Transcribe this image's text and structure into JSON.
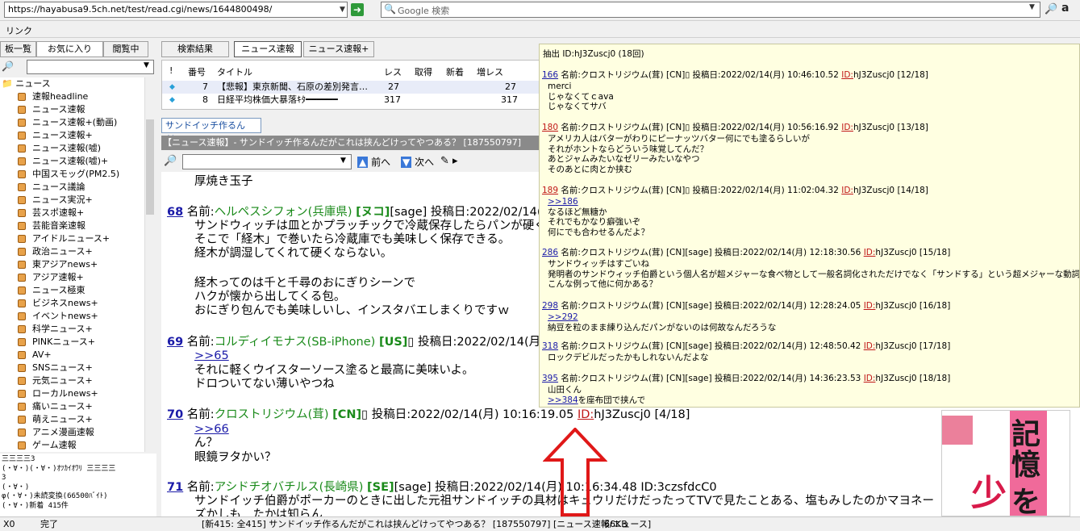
{
  "toolbar": {
    "url": "https://hayabusa9.5ch.net/test/read.cgi/news/1644800498/",
    "search_placeholder": "Google 検索",
    "amazon": "a"
  },
  "linkbar": {
    "label": "リンク"
  },
  "left_tabs": [
    "板一覧",
    "お気に入り",
    "閲覧中"
  ],
  "tree": {
    "root": "ニュース",
    "items": [
      "速報headline",
      "ニュース速報",
      "ニュース速報+(動画)",
      "ニュース速報+",
      "ニュース速報(嘘)",
      "ニュース速報(嘘)+",
      "中国スモッグ(PM2.5)",
      "ニュース議論",
      "ニュース実況+",
      "芸スポ速報+",
      "芸能音楽速報",
      "アイドルニュース+",
      "政治ニュース+",
      "東アジアnews+",
      "アジア速報+",
      "ニュース極東",
      "ビジネスnews+",
      "イベントnews+",
      "科学ニュース+",
      "PINKニュース+",
      "AV+",
      "SNSニュース+",
      "元気ニュース+",
      "ローカルnews+",
      "痛いニュース+",
      "萌えニュース+",
      "アニメ漫画速報",
      "ゲーム速報"
    ]
  },
  "aa_box": "三三三三3\n(・∀・)(・∀・)ｵﾂｶｲｵﾜﾘ 三三三三\n3\n(・∀・)\nφ(・∀・)未読変換(66500ﾊﾞｲﾄ)\n(・∀・)新着 415件",
  "board_tabs": [
    "検索結果",
    "ニュース速報",
    "ニュース速報+"
  ],
  "thread_list": {
    "headers": [
      "!",
      "番号",
      "タイトル",
      "レス",
      "取得",
      "新着",
      "増レス"
    ],
    "rows": [
      {
        "no": "7",
        "title": "【悲報】東京新聞、石原の差別発言…",
        "res": "27",
        "inc": "27"
      },
      {
        "no": "8",
        "title": "日経平均株価大暴落ｷﾀ━━━━━━",
        "res": "317",
        "inc": "317"
      }
    ]
  },
  "thread_tab": "サンドイッチ作るんだ…",
  "thread_title": "【ニュース速報】- サンドイッチ作るんだがこれは挟んどけってやつある？ [187550797]",
  "nav": {
    "prev": "前へ",
    "next": "次へ"
  },
  "posts": {
    "top_line": "厚焼き玉子",
    "p68": {
      "num": "68",
      "label": "名前:",
      "name": "ヘルペスシフォン(兵庫県)",
      "tag": "[ヌコ]",
      "sage": "[sage]",
      "date": "投稿日:2022/02/14(月",
      "lines": [
        "サンドウィッチは皿とかプラッチックで冷蔵保存したらパンが硬くな",
        "そこで「経木」で巻いたら冷蔵庫でも美味しく保存できる。",
        "経木が調湿してくれて硬くならない。",
        "",
        "経木ってのは千と千尋のおにぎりシーンで",
        "ハクが懐から出してくる包。",
        "おにぎり包んでも美味しいし、インスタバエしまくりですｗ"
      ]
    },
    "p69": {
      "num": "69",
      "label": "名前:",
      "name": "コルディイモナス(SB-iPhone)",
      "tag": "[US]",
      "date": "投稿日:2022/02/14(月",
      "anchor": ">>65",
      "lines": [
        "それに軽くウイスターソース塗ると最高に美味いよ。",
        "ドロついてない薄いやつね"
      ]
    },
    "p70": {
      "num": "70",
      "label": "名前:",
      "name": "クロストリジウム(茸)",
      "tag": "[CN]",
      "date": "投稿日:2022/02/14(月) 10:16:19.05",
      "id_label": "ID:",
      "id": "hJ3Zuscj0 [4/18]",
      "anchor": ">>66",
      "lines": [
        "ん？",
        "眼鏡ヲタかい？"
      ]
    },
    "p71": {
      "num": "71",
      "label": "名前:",
      "name": "アシドチオバチルス(長崎県)",
      "tag": "[SE]",
      "sage": "[sage]",
      "date": "投稿日:2022/02/14(月) 10:16:34.48",
      "id": "ID:3czsfdcC0",
      "lines": [
        "サンドイッチ伯爵がポーカーのときに出した元祖サンドイッチの具材はキュウリだけだったってTVで見たことある、塩もみしたのかマヨネー",
        "ズかしも…たかは知らん"
      ]
    }
  },
  "popup": {
    "header": "抽出 ID:hJ3Zuscj0 (18回)",
    "entries": [
      {
        "num": "166",
        "red": false,
        "head": "名前:クロストリジウム(茸) [CN]▯ 投稿日:2022/02/14(月) 10:46:10.52",
        "idl": "ID:",
        "idv": "hJ3Zuscj0 [12/18]",
        "lines": [
          "merci",
          "じゃなくてｃava",
          "じゃなくてサバ"
        ]
      },
      {
        "num": "180",
        "red": true,
        "head": "名前:クロストリジウム(茸) [CN]▯ 投稿日:2022/02/14(月) 10:56:16.92",
        "idl": "ID:",
        "idv": "hJ3Zuscj0 [13/18]",
        "lines": [
          "アメリカ人はバターがわりにピーナッツバター何にでも塗るらしいが",
          "それがホントならどういう味覚してんだ？",
          "あとジャムみたいなゼリーみたいなやつ",
          "そのあとに肉とか挟む"
        ]
      },
      {
        "num": "189",
        "red": true,
        "head": "名前:クロストリジウム(茸) [CN]▯ 投稿日:2022/02/14(月) 11:02:04.32",
        "idl": "ID:",
        "idv": "hJ3Zuscj0 [14/18]",
        "anchor": ">>186",
        "lines": [
          "なるほど無糖か",
          "それでもかなり癖強いぞ",
          "何にでも合わせるんだよ？"
        ]
      },
      {
        "num": "286",
        "red": false,
        "head": "名前:クロストリジウム(茸) [CN][sage] 投稿日:2022/02/14(月) 12:18:30.56",
        "idl": "ID:",
        "idv": "hJ3Zuscj0 [15/18]",
        "lines": [
          "サンドウィッチはすごいね",
          "発明者のサンドウィッチ伯爵という個人名が超メジャーな食べ物として一般名詞化されただけでなく「サンドする」という超メジャーな動詞も派生し",
          "こんな例って他に何かある？"
        ]
      },
      {
        "num": "298",
        "red": false,
        "head": "名前:クロストリジウム(茸) [CN][sage] 投稿日:2022/02/14(月) 12:28:24.05",
        "idl": "ID:",
        "idv": "hJ3Zuscj0 [16/18]",
        "anchor": ">>292",
        "lines": [
          "納豆を粒のまま練り込んだパンがないのは何故なんだろうな"
        ]
      },
      {
        "num": "318",
        "red": false,
        "head": "名前:クロストリジウム(茸) [CN][sage] 投稿日:2022/02/14(月) 12:48:50.42",
        "idl": "ID:",
        "idv": "hJ3Zuscj0 [17/18]",
        "lines": [
          "ロックデビルだったかもしれないんだよな"
        ]
      },
      {
        "num": "395",
        "red": false,
        "head": "名前:クロストリジウム(茸) [CN][sage] 投稿日:2022/02/14(月) 14:36:23.53",
        "idl": "ID:",
        "idv": "hJ3Zuscj0 [18/18]",
        "lines": [
          "山田くん"
        ],
        "anchor_line": ">>384",
        "anchor_tail": "を座布団で挟んで"
      }
    ]
  },
  "image_text": [
    "記",
    "憶",
    "を",
    "少"
  ],
  "status": {
    "left": "X0",
    "state": "完了",
    "info": "[新415: 全415] サンドイッチ作るんだがこれは挟んどけってやつある？ [187550797] [ニュース速報/ニュース]",
    "size": "66KB"
  },
  "colors": {
    "accent_red": "#c01818",
    "link_blue": "#1a1aa8",
    "name_green": "#1a8a1a",
    "popup_bg": "#ffffe1"
  }
}
